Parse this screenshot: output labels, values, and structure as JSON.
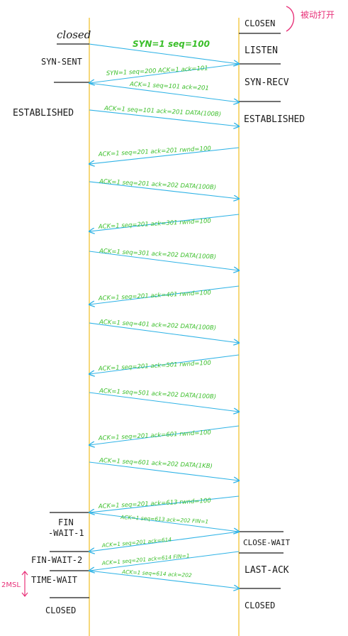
{
  "annotation": {
    "text": "被动打开",
    "color": "#e8337a"
  },
  "colors": {
    "lifeline": "#f0c232",
    "arrow": "#2fb3e6",
    "message": "#3bbf2a",
    "state": "#1a1a1a",
    "timer": "#e8337a"
  },
  "client": {
    "states": [
      {
        "id": "closed",
        "label": "closed"
      },
      {
        "id": "syn-sent",
        "label": "SYN-SENT"
      },
      {
        "id": "established",
        "label": "ESTABLISHED"
      },
      {
        "id": "fin-wait-1a",
        "label": "FIN"
      },
      {
        "id": "fin-wait-1b",
        "label": "-WAIT-1"
      },
      {
        "id": "fin-wait-2",
        "label": "FIN-WAIT-2"
      },
      {
        "id": "time-wait",
        "label": "TIME-WAIT"
      },
      {
        "id": "closed-end",
        "label": "CLOSED"
      }
    ]
  },
  "server": {
    "states": [
      {
        "id": "closed",
        "label": "CLOSEN"
      },
      {
        "id": "listen",
        "label": "LISTEN"
      },
      {
        "id": "syn-recv",
        "label": "SYN-RECV"
      },
      {
        "id": "established",
        "label": "ESTABLISHED"
      },
      {
        "id": "close-wait",
        "label": "CLOSE-WAIT"
      },
      {
        "id": "last-ack",
        "label": "LAST-ACK"
      },
      {
        "id": "closed-end",
        "label": "CLOSED"
      }
    ]
  },
  "timer": {
    "label": "2MSL"
  },
  "messages": [
    {
      "dir": "c2s",
      "label": "SYN=1  seq=100"
    },
    {
      "dir": "s2c",
      "label": "SYN=1  seq=200  ACK=1  ack=101"
    },
    {
      "dir": "c2s",
      "label": "ACK=1  seq=101  ack=201"
    },
    {
      "dir": "c2s",
      "label": "ACK=1  seq=101  ack=201  DATA(100B)"
    },
    {
      "dir": "s2c",
      "label": "ACK=1  seq=201  ack=201  rwnd=100"
    },
    {
      "dir": "c2s",
      "label": "ACK=1  seq=201  ack=202  DATA(100B)"
    },
    {
      "dir": "s2c",
      "label": "ACK=1  seq=201  ack=301  rwnd=100"
    },
    {
      "dir": "c2s",
      "label": "ACK=1  seq=301  ack=202  DATA(100B)"
    },
    {
      "dir": "s2c",
      "label": "ACK=1  seq=201  ack=401  rwnd=100"
    },
    {
      "dir": "c2s",
      "label": "ACK=1  seq=401  ack=202  DATA(100B)"
    },
    {
      "dir": "s2c",
      "label": "ACK=1  seq=201  ack=501  rwnd=100"
    },
    {
      "dir": "c2s",
      "label": "ACK=1  seq=501  ack=202  DATA(100B)"
    },
    {
      "dir": "s2c",
      "label": "ACK=1  seq=201  ack=601  rwnd=100"
    },
    {
      "dir": "c2s",
      "label": "ACK=1  seq=601  ack=202  DATA(1KB)"
    },
    {
      "dir": "s2c",
      "label": "ACK=1  seq=201  ack=613  rwnd=100"
    },
    {
      "dir": "c2s",
      "label": "ACK=1  seq=613  ack=202  FIN=1"
    },
    {
      "dir": "s2c",
      "label": "ACK=1  seq=201  ack=614"
    },
    {
      "dir": "s2c",
      "label": "ACK=1  seq=201  ack=614  FIN=1"
    },
    {
      "dir": "c2s",
      "label": "ACK=1  seq=614  ack=202"
    }
  ]
}
